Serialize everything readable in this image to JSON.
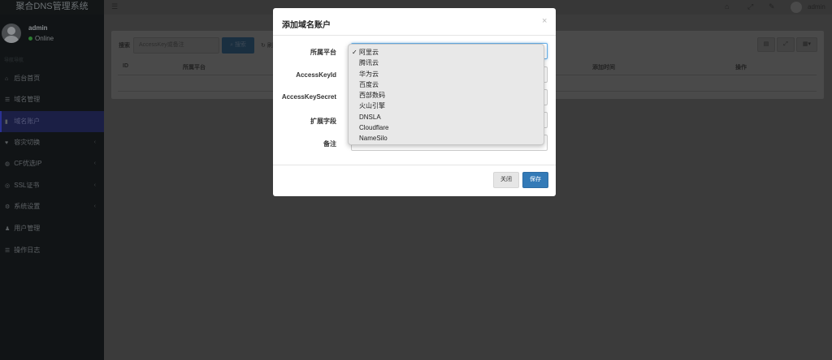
{
  "app": {
    "title": "聚合DNS管理系统"
  },
  "user": {
    "name": "admin",
    "status": "Online"
  },
  "sidebar": {
    "header": "导航导航",
    "items": [
      {
        "label": "后台首页",
        "icon": "home-icon",
        "glyph": "⌂"
      },
      {
        "label": "域名管理",
        "icon": "list-icon",
        "glyph": "☰"
      },
      {
        "label": "域名账户",
        "icon": "lock-icon",
        "glyph": "▮"
      },
      {
        "label": "容灾切换",
        "icon": "heartbeat-icon",
        "glyph": "♥"
      },
      {
        "label": "CF优选IP",
        "icon": "globe-icon",
        "glyph": "◍"
      },
      {
        "label": "SSL证书",
        "icon": "certificate-icon",
        "glyph": "◎"
      },
      {
        "label": "系统设置",
        "icon": "gears-icon",
        "glyph": "⚙"
      },
      {
        "label": "用户管理",
        "icon": "user-icon",
        "glyph": "♟"
      },
      {
        "label": "操作日志",
        "icon": "log-icon",
        "glyph": "☰"
      }
    ]
  },
  "topbar": {
    "user": "admin"
  },
  "toolbar": {
    "search_label": "搜索",
    "search_placeholder": "AccessKey或备注",
    "search_button": "搜索",
    "refresh_label": "刷"
  },
  "table": {
    "headers": [
      "ID",
      "所属平台",
      "添加时间",
      "操作"
    ]
  },
  "modal": {
    "title": "添加域名账户",
    "fields": [
      {
        "label": "所属平台",
        "value": "阿里云"
      },
      {
        "label": "AccessKeyId",
        "value": ""
      },
      {
        "label": "AccessKeySecret",
        "value": ""
      },
      {
        "label": "扩展字段",
        "value": ""
      },
      {
        "label": "备注",
        "value": ""
      }
    ],
    "close_button": "关闭",
    "save_button": "保存"
  },
  "dropdown": {
    "selected": "阿里云",
    "options": [
      "阿里云",
      "腾讯云",
      "华为云",
      "百度云",
      "西部数码",
      "火山引擎",
      "DNSLA",
      "Cloudflare",
      "NameSilo"
    ]
  },
  "colors": {
    "primary": "#337ab7",
    "sidebar_bg": "#111416",
    "online": "#00a65a"
  }
}
